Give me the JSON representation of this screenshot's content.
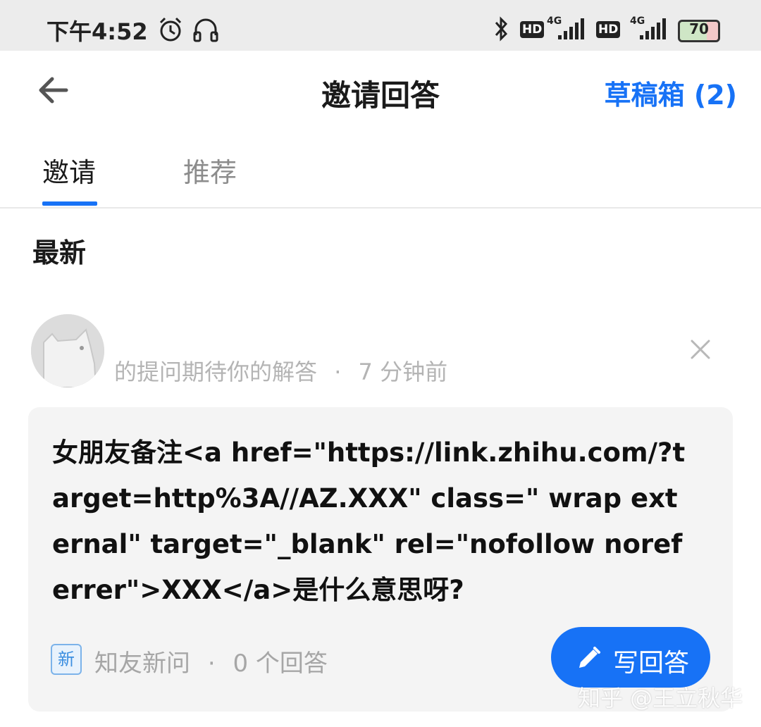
{
  "status_bar": {
    "time": "下午4:52",
    "hd_1": "HD",
    "net_1": "4G",
    "hd_2": "HD",
    "net_2": "4G",
    "battery": "70",
    "icons": [
      "alarm-icon",
      "headset-icon",
      "bluetooth-icon",
      "signal-icon",
      "battery-icon"
    ]
  },
  "header": {
    "title": "邀请回答",
    "drafts_label": "草稿箱 (2)",
    "accent_color": "#1772f6"
  },
  "tabs": [
    {
      "label": "邀请",
      "active": true
    },
    {
      "label": "推荐",
      "active": false
    }
  ],
  "section": {
    "title": "最新"
  },
  "invite": {
    "meta_text": "的提问期待你的解答",
    "separator": "·",
    "time_ago": "7 分钟前",
    "question": "女朋友备注<a href=\"https://link.zhihu.com/?target=http%3A//AZ.XXX\" class=\" wrap external\" target=\"_blank\" rel=\"nofollow noreferrer\">XXX</a>是什么意思呀?",
    "badge": "新",
    "source": "知友新问",
    "answers": "0 个回答",
    "answer_button": "写回答"
  },
  "watermark": "知乎 @王立秋华"
}
